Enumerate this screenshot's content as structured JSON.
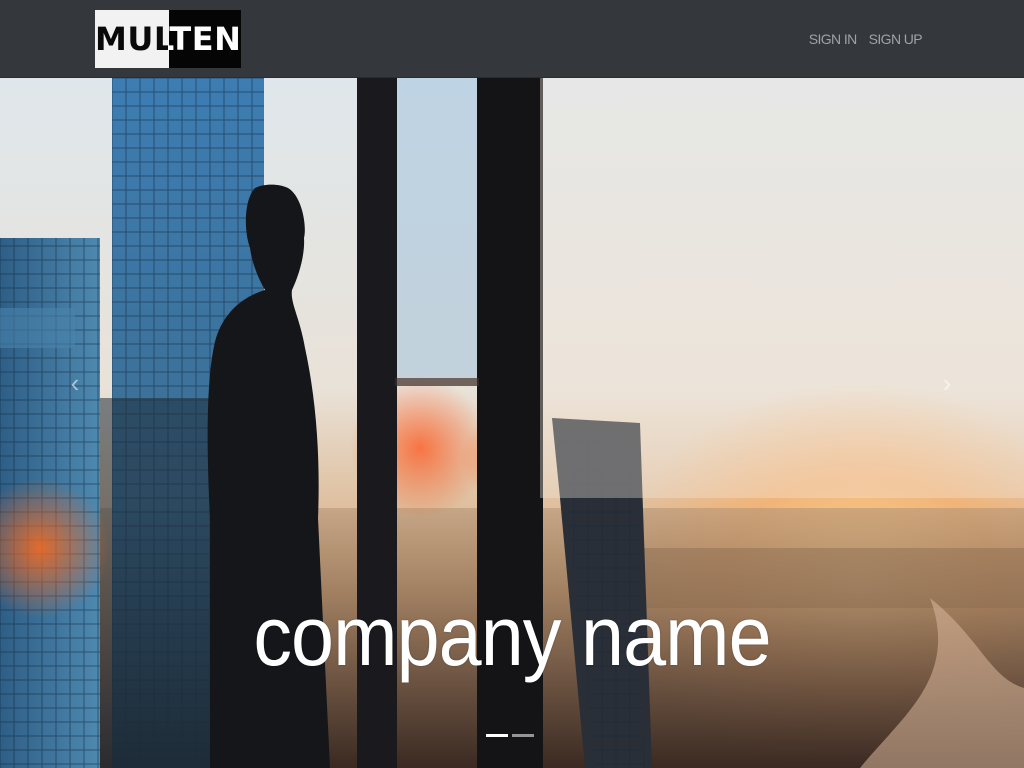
{
  "brand": {
    "logo_text": "MULTEN"
  },
  "nav": {
    "items": [
      {
        "label": "SIGN IN"
      },
      {
        "label": "SIGN UP"
      }
    ]
  },
  "hero": {
    "title": "company name",
    "prev_icon": "chevron-left-icon",
    "next_icon": "chevron-right-icon",
    "slides": 2,
    "active_slide": 1
  },
  "colors": {
    "navbar": "#34373b",
    "nav_link": "#9ea2a7",
    "hero_text": "#ffffff"
  }
}
